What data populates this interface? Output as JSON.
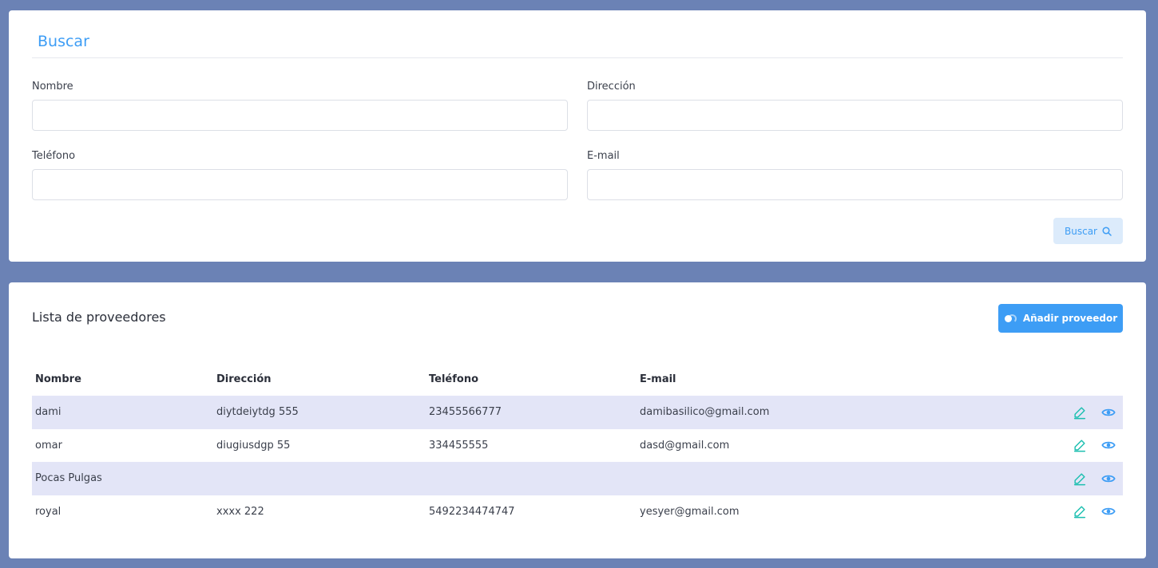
{
  "search": {
    "title": "Buscar",
    "fields": {
      "nombre": {
        "label": "Nombre",
        "value": "",
        "placeholder": ""
      },
      "direccion": {
        "label": "Dirección",
        "value": "",
        "placeholder": ""
      },
      "telefono": {
        "label": "Teléfono",
        "value": "",
        "placeholder": ""
      },
      "email": {
        "label": "E-mail",
        "value": "",
        "placeholder": ""
      }
    },
    "button_label": "Buscar",
    "button_icon": "search-icon"
  },
  "list": {
    "title": "Lista de proveedores",
    "add_button_label": "Añadir proveedor",
    "add_button_icon": "toggle-icon",
    "columns": [
      "Nombre",
      "Dirección",
      "Teléfono",
      "E-mail"
    ],
    "rows": [
      {
        "nombre": "dami",
        "direccion": "diytdeiytdg 555",
        "telefono": "23455566777",
        "email": "damibasilico@gmail.com"
      },
      {
        "nombre": "omar",
        "direccion": "diugiusdgp 55",
        "telefono": "334455555",
        "email": "dasd@gmail.com"
      },
      {
        "nombre": "Pocas Pulgas",
        "direccion": "",
        "telefono": "",
        "email": ""
      },
      {
        "nombre": "royal",
        "direccion": "xxxx 222",
        "telefono": "5492234474747",
        "email": "yesyer@gmail.com"
      }
    ],
    "row_actions": [
      "edit-icon",
      "view-icon"
    ]
  },
  "colors": {
    "background": "#6b82b5",
    "accent": "#3d9df5",
    "edit_icon": "#1cbfb0",
    "striped_row": "#e3e5f7"
  }
}
